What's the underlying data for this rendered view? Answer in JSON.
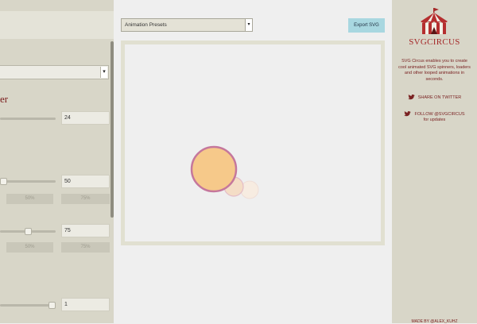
{
  "left_panel": {
    "section_heading": "er",
    "rows": [
      {
        "value": "24"
      },
      {
        "value": "50",
        "buttons": [
          "50%",
          "75%"
        ]
      },
      {
        "value": "75",
        "buttons": [
          "50%",
          "75%"
        ]
      },
      {
        "value": "1"
      }
    ]
  },
  "toolbar": {
    "preset_label": "Animation Presets",
    "export_label": "Export SVG"
  },
  "brand": {
    "logo_svg": "SVG",
    "logo_circus": "CIRCUS",
    "description": "SVG Circus enables you to create cool animated SVG spinners, loaders and other looped animations in seconds.",
    "share_label": "SHARE ON TWITTER",
    "follow_label": "FOLLOW @SVGCIRCUS",
    "follow_sub": "for updates",
    "footer": "MADE BY @ALEX_KUHZ"
  },
  "colors": {
    "accent": "#a52a2a",
    "export_button": "#a8d7e0",
    "circle_fill": "#f6c98a",
    "circle_stroke": "#c5779c"
  }
}
